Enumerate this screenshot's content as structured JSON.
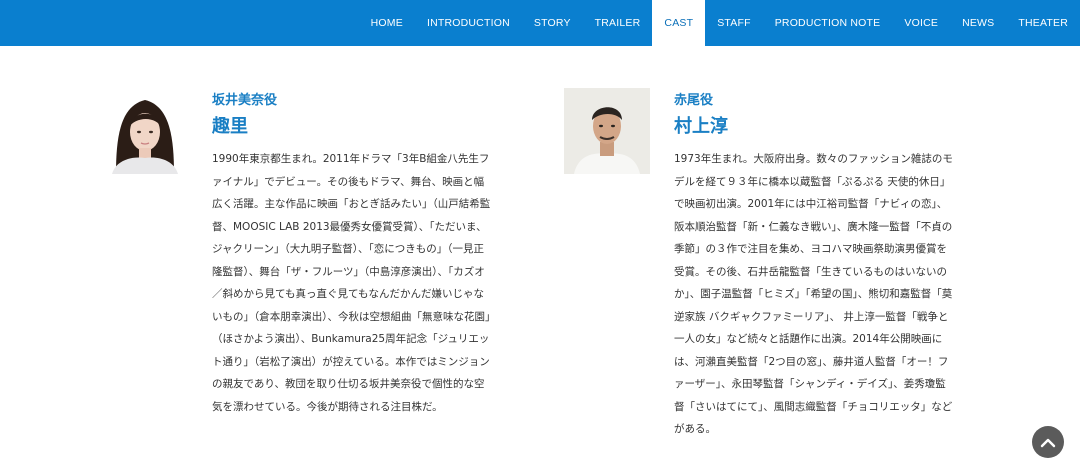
{
  "nav": {
    "items": [
      "HOME",
      "INTRODUCTION",
      "STORY",
      "TRAILER",
      "CAST",
      "STAFF",
      "PRODUCTION NOTE",
      "VOICE",
      "NEWS",
      "THEATER"
    ],
    "active": "CAST"
  },
  "cast": [
    {
      "role": "坂井美奈役",
      "name": "趣里",
      "bio": "1990年東京都生まれ。2011年ドラマ「3年B組金八先生ファイナル」でデビュー。その後もドラマ、舞台、映画と幅広く活躍。主な作品に映画「おとぎ話みたい」（山戸結希監督、MOOSIC LAB 2013最優秀女優賞受賞）、「ただいま、ジャクリーン」（大九明子監督）、「恋につきもの」（一見正隆監督）、舞台「ザ・フルーツ」（中島淳彦演出）、「カズオ／斜めから見ても真っ直ぐ見てもなんだかんだ嫌いじゃないもの」（倉本朋幸演出）、今秋は空想組曲「無意味な花園」（ほさかよう演出）、Bunkamura25周年記念「ジュリエット通り」（岩松了演出）が控えている。本作ではミンジョンの親友であり、教団を取り仕切る坂井美奈役で個性的な空気を漂わせている。今後が期待される注目株だ。"
    },
    {
      "role": "赤尾役",
      "name": "村上淳",
      "bio": "1973年生まれ。大阪府出身。数々のファッション雑誌のモデルを経て９３年に橋本以蔵監督「ぷるぷる 天使的休日」で映画初出演。2001年には中江裕司監督「ナビィの恋」、阪本順治監督「新・仁義なき戦い」、廣木隆一監督「不貞の季節」の３作で注目を集め、ヨコハマ映画祭助演男優賞を受賞。その後、石井岳龍監督「生きているものはいないのか」、園子温監督「ヒミズ」「希望の国」、熊切和嘉監督「莫逆家族 バクギャクファミーリア」、 井上淳一監督「戦争と一人の女」など続々と話題作に出演。2014年公開映画には、河瀨直美監督「2つ目の窓」、藤井道人監督「オー！ファーザー」、永田琴監督「シャンディ・デイズ」、姜秀瓊監督「さいはてにて」、風間志織監督「チョコリエッタ」などがある。"
    }
  ],
  "colors": {
    "nav_bg": "#0a7fcf",
    "accent": "#1a7fc4"
  },
  "icons": {
    "scroll_top": "chevron-up-icon"
  }
}
